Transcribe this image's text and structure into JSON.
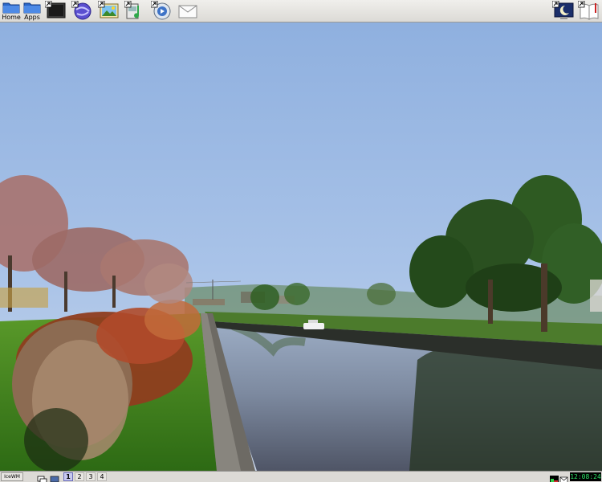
{
  "top_panel": {
    "launchers": [
      {
        "label": "Home",
        "icon": "home-folder-icon"
      },
      {
        "label": "Apps",
        "icon": "apps-folder-icon"
      },
      {
        "label": "",
        "icon": "terminal-icon"
      },
      {
        "label": "",
        "icon": "web-browser-icon"
      },
      {
        "label": "",
        "icon": "image-viewer-icon"
      },
      {
        "label": "",
        "icon": "audio-player-icon"
      },
      {
        "label": "",
        "icon": "media-player-icon"
      },
      {
        "label": "",
        "icon": "mail-envelope-icon"
      }
    ],
    "tray_right": [
      {
        "icon": "desktop-moon-icon"
      },
      {
        "icon": "help-book-icon"
      }
    ]
  },
  "bottom_panel": {
    "menu_button_label": "IceWM",
    "workspaces": [
      "1",
      "2",
      "3",
      "4"
    ],
    "active_workspace": "1",
    "clock": "12:08:24"
  },
  "colors": {
    "panel_bg": "#dcdad6",
    "workspace_active": "#c7c9f0",
    "clock_fg": "#2ee66a",
    "clock_bg": "#000000"
  }
}
